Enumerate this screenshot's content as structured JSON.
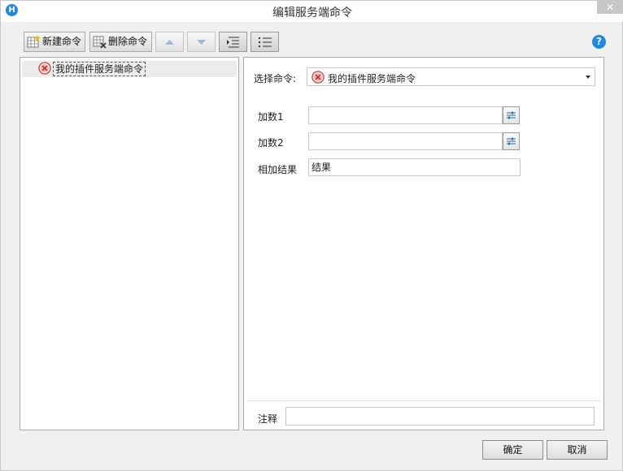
{
  "window": {
    "title": "编辑服务端命令",
    "close_glyph": "✕",
    "app_icon_glyph": "H"
  },
  "toolbar": {
    "new_label": "新建命令",
    "delete_label": "删除命令",
    "help_glyph": "?"
  },
  "tree": {
    "items": [
      {
        "label": "我的插件服务端命令",
        "icon": "error-icon"
      }
    ]
  },
  "form": {
    "select_label": "选择命令:",
    "select_value": "我的插件服务端命令",
    "fields": [
      {
        "label": "加数1",
        "value": ""
      },
      {
        "label": "加数2",
        "value": ""
      },
      {
        "label": "相加结果",
        "value": "结果"
      }
    ],
    "note_label": "注释",
    "note_value": ""
  },
  "footer": {
    "ok_label": "确定",
    "cancel_label": "取消"
  },
  "colors": {
    "accent": "#1e88e5",
    "error": "#d9534f"
  }
}
